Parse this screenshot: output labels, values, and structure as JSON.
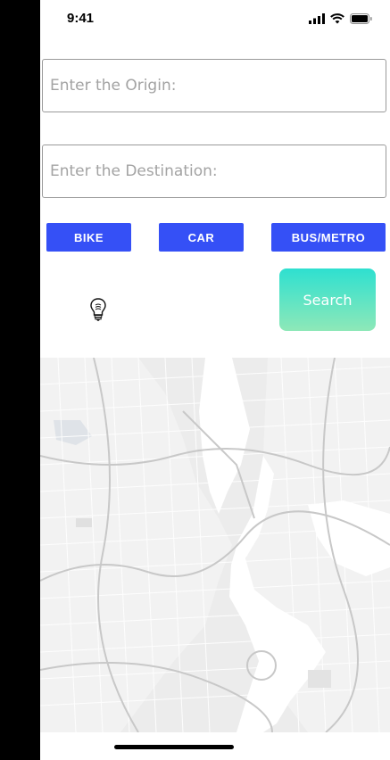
{
  "status_bar": {
    "time": "9:41"
  },
  "origin_input": {
    "placeholder": "Enter the Origin:"
  },
  "destination_input": {
    "placeholder": "Enter the Destination:"
  },
  "modes": {
    "bike": "BIKE",
    "car": "CAR",
    "bus_metro": "BUS/METRO"
  },
  "search_button": {
    "label": "Search"
  },
  "colors": {
    "mode_button": "#3550f6",
    "search_gradient_top": "#2ee0d0",
    "search_gradient_bottom": "#8ee8b8"
  },
  "icons": {
    "bulb": "lightbulb-icon"
  }
}
